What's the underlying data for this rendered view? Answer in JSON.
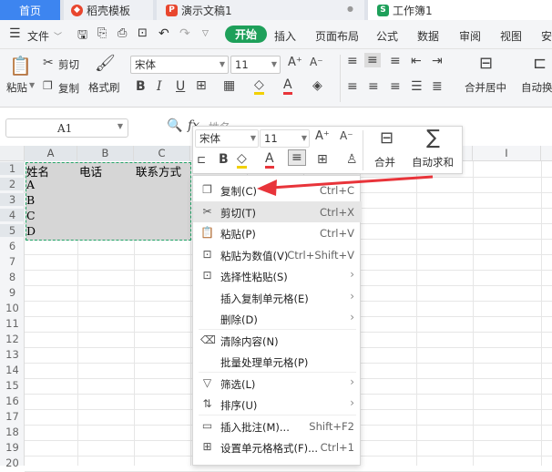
{
  "tabs": [
    {
      "label": "首页",
      "icon": ""
    },
    {
      "label": "稻壳模板",
      "icon": "docer-icon",
      "color": "#e8462e"
    },
    {
      "label": "演示文稿1",
      "icon": "presentation-icon",
      "color": "#e8462e",
      "ico_text": "P"
    },
    {
      "label": "工作簿1",
      "icon": "spreadsheet-icon",
      "color": "#1ea05a",
      "ico_text": "S"
    }
  ],
  "tab_dot": "●",
  "menu": {
    "file": "文件",
    "start": "开始",
    "insert": "插入",
    "layout": "页面布局",
    "formula": "公式",
    "data": "数据",
    "review": "审阅",
    "view": "视图",
    "security": "安"
  },
  "ribbon": {
    "paste": "粘贴",
    "cut": "剪切",
    "copy": "复制",
    "format_painter": "格式刷",
    "font": "宋体",
    "size": "11",
    "merge": "合并居中",
    "autowrap": "自动换"
  },
  "name_box": "A1",
  "formula_text": "姓名",
  "columns": [
    "A",
    "B",
    "C",
    "D",
    "E",
    "F",
    "G",
    "H",
    "I"
  ],
  "rows": [
    "1",
    "2",
    "3",
    "4",
    "5",
    "6",
    "7",
    "8",
    "9",
    "10",
    "11",
    "12",
    "13",
    "14",
    "15",
    "16",
    "17",
    "18",
    "19",
    "20"
  ],
  "cells": {
    "A1": "姓名",
    "B1": "电话",
    "C1": "联系方式",
    "A2": "A",
    "A3": "B",
    "A4": "C",
    "A5": "D"
  },
  "mini_toolbar": {
    "font": "宋体",
    "size": "11",
    "merge": "合并",
    "autosum": "自动求和"
  },
  "context_menu": [
    {
      "label": "复制(C)",
      "shortcut": "Ctrl+C",
      "icon": "copy-icon"
    },
    {
      "label": "剪切(T)",
      "shortcut": "Ctrl+X",
      "icon": "scissors-icon"
    },
    {
      "label": "粘贴(P)",
      "shortcut": "Ctrl+V",
      "icon": "paste-icon"
    },
    {
      "label": "粘贴为数值(V)",
      "shortcut": "Ctrl+Shift+V",
      "icon": "paste-values-icon"
    },
    {
      "label": "选择性粘贴(S)",
      "shortcut": "",
      "icon": "paste-special-icon",
      "submenu": true
    },
    {
      "label": "插入复制单元格(E)",
      "shortcut": "",
      "icon": "",
      "submenu": true
    },
    {
      "label": "删除(D)",
      "shortcut": "",
      "icon": "",
      "submenu": true
    },
    {
      "label": "清除内容(N)",
      "shortcut": "",
      "icon": "eraser-icon"
    },
    {
      "label": "批量处理单元格(P)",
      "shortcut": "",
      "icon": ""
    },
    {
      "label": "筛选(L)",
      "shortcut": "",
      "icon": "filter-icon",
      "submenu": true
    },
    {
      "label": "排序(U)",
      "shortcut": "",
      "icon": "sort-icon",
      "submenu": true
    },
    {
      "label": "插入批注(M)...",
      "shortcut": "Shift+F2",
      "icon": "comment-icon"
    },
    {
      "label": "设置单元格格式(F)...",
      "shortcut": "Ctrl+1",
      "icon": "format-cells-icon"
    }
  ],
  "colors": {
    "accent": "#1ea05a",
    "tab_active": "#3d85f0",
    "arrow": "#e8343a",
    "selection": "#d9d9d9"
  }
}
